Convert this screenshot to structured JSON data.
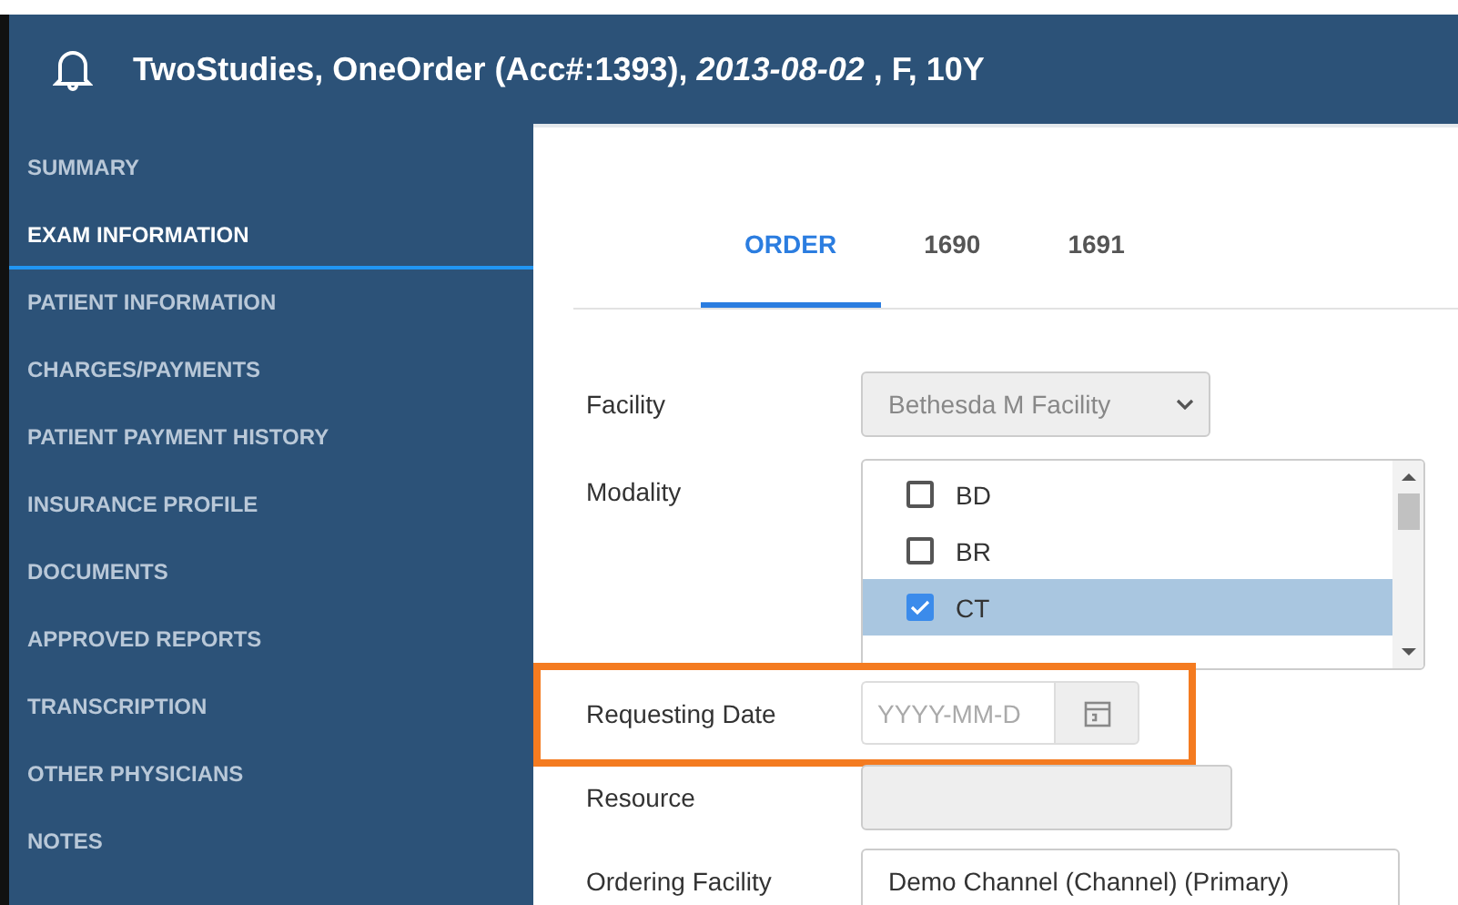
{
  "header": {
    "title": "TwoStudies, OneOrder (Acc#:1393), *2013-08-02* , F, 10Y"
  },
  "sidebar": {
    "items": [
      {
        "label": "SUMMARY",
        "selected": false
      },
      {
        "label": "EXAM INFORMATION",
        "selected": true
      },
      {
        "label": "PATIENT INFORMATION",
        "selected": false
      },
      {
        "label": "CHARGES/PAYMENTS",
        "selected": false
      },
      {
        "label": "PATIENT PAYMENT HISTORY",
        "selected": false
      },
      {
        "label": "INSURANCE PROFILE",
        "selected": false
      },
      {
        "label": "DOCUMENTS",
        "selected": false
      },
      {
        "label": "APPROVED REPORTS",
        "selected": false
      },
      {
        "label": "TRANSCRIPTION",
        "selected": false
      },
      {
        "label": "OTHER PHYSICIANS",
        "selected": false
      },
      {
        "label": "NOTES",
        "selected": false
      }
    ]
  },
  "tabs": [
    {
      "label": "ORDER",
      "selected": true
    },
    {
      "label": "1690",
      "selected": false
    },
    {
      "label": "1691",
      "selected": false
    }
  ],
  "form": {
    "facility": {
      "label": "Facility",
      "value": "Bethesda M Facility",
      "disabled": true
    },
    "modality": {
      "label": "Modality",
      "items": [
        {
          "label": "BD",
          "checked": false,
          "selected": false
        },
        {
          "label": "BR",
          "checked": false,
          "selected": false
        },
        {
          "label": "CT",
          "checked": true,
          "selected": true
        }
      ]
    },
    "requesting_date": {
      "label": "Requesting Date",
      "placeholder": "YYYY-MM-D",
      "highlighted": true
    },
    "resource": {
      "label": "Resource",
      "disabled": true
    },
    "ordering_facility": {
      "label": "Ordering Facility",
      "value": "Demo Channel (Channel) (Primary)"
    }
  }
}
